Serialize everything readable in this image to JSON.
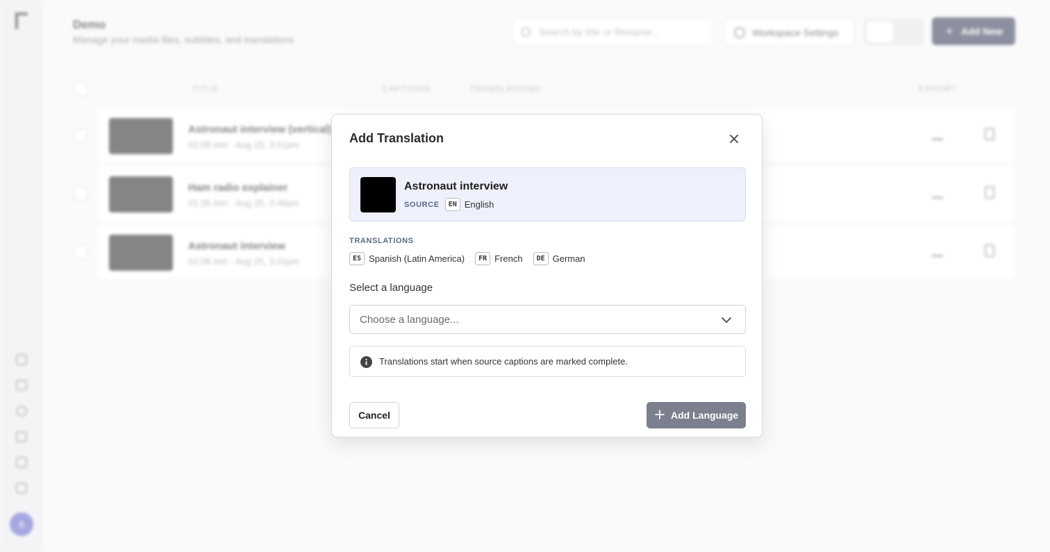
{
  "background": {
    "page_title": "Demo",
    "page_subtitle": "Manage your media files, subtitles, and translations",
    "search_placeholder": "Search by title or filename...",
    "workspace_settings_label": "Workspace Settings",
    "add_new_label": "Add New",
    "avatar_initial": "A",
    "columns": [
      "TITLE",
      "CAPTIONS",
      "TRANSLATIONS",
      "EXPORT"
    ],
    "rows": [
      {
        "title": "Astronaut interview (vertical)",
        "meta": "02:08 min · Aug 25, 3:51pm"
      },
      {
        "title": "Ham radio explainer",
        "meta": "01:35 min · Aug 25, 3:46pm"
      },
      {
        "title": "Astronaut interview",
        "meta": "02:08 min · Aug 25, 3:41pm"
      }
    ]
  },
  "modal": {
    "title": "Add Translation",
    "media": {
      "title": "Astronaut interview",
      "source_label": "SOURCE",
      "source_code": "EN",
      "source_language": "English"
    },
    "translations_heading": "TRANSLATIONS",
    "translations": [
      {
        "code": "ES",
        "name": "Spanish (Latin America)"
      },
      {
        "code": "FR",
        "name": "French"
      },
      {
        "code": "DE",
        "name": "German"
      }
    ],
    "select_label": "Select a language",
    "select_placeholder": "Choose a language...",
    "info_text": "Translations start when source captions are marked complete.",
    "cancel_label": "Cancel",
    "add_language_label": "Add Language"
  },
  "icons": {
    "close": "close-icon",
    "chevron": "chevron-down-icon",
    "info": "info-icon",
    "plus": "plus-icon"
  },
  "colors": {
    "primary_disabled": "#7b7f8e",
    "media_card_bg": "#eef1fb",
    "label_accent": "#5b6a87"
  }
}
